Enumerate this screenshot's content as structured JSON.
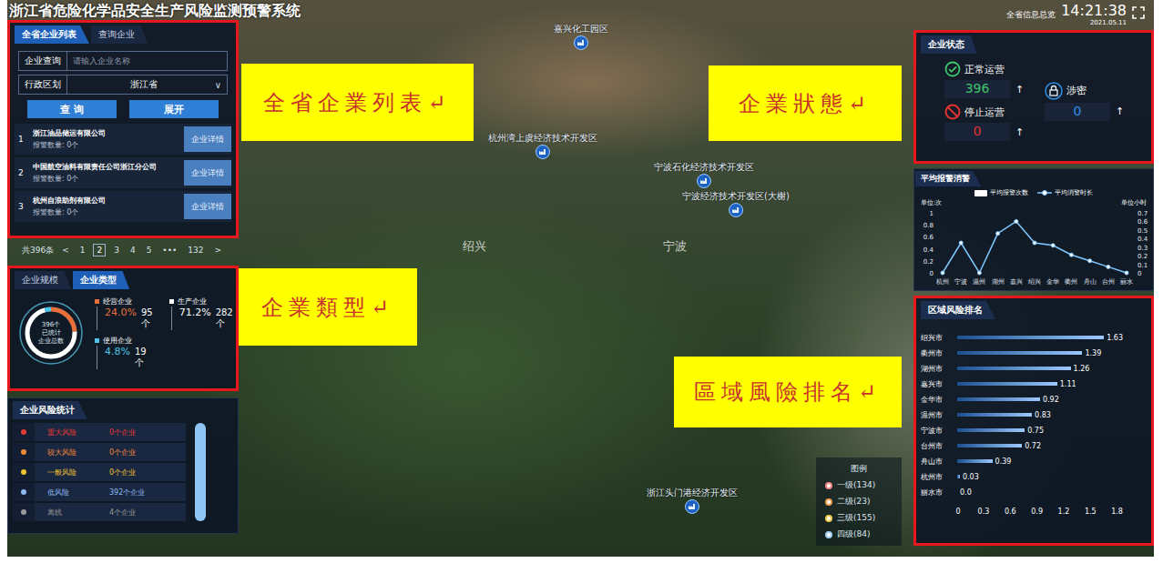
{
  "header": {
    "title": "浙江省危险化学品安全生产风险监测预警系统",
    "overview": "全省信息总览",
    "time": "14:21:38",
    "date": "2021.05.11"
  },
  "enterprise_list": {
    "highlighted": true,
    "tabs": [
      {
        "label": "全省企业列表",
        "selected": true
      },
      {
        "label": "查询企业",
        "selected": false
      }
    ],
    "search": {
      "label": "企业查询",
      "placeholder": "请输入企业名称"
    },
    "region": {
      "label": "行政区划",
      "value": "浙江省",
      "arrow": "∨"
    },
    "buttons": [
      "查 询",
      "展开"
    ],
    "items": [
      {
        "index": "1",
        "name": "浙江油品储运有限公司",
        "alarms": "报警数量: 0个",
        "action": "企业详情"
      },
      {
        "index": "2",
        "name": "中国航空油料有限责任公司浙江分公司",
        "alarms": "报警数量: 0个",
        "action": "企业详情"
      },
      {
        "index": "3",
        "name": "杭州自浪助剂有限公司",
        "alarms": "报警数量: 0个",
        "action": "企业详情"
      }
    ],
    "pagination": {
      "total": "共396条",
      "prev": "<",
      "next": ">",
      "pages": [
        {
          "label": "1",
          "selected": false
        },
        {
          "label": "2",
          "selected": true
        },
        {
          "label": "3",
          "selected": false
        },
        {
          "label": "4",
          "selected": false
        },
        {
          "label": "5",
          "selected": false
        },
        {
          "label": "•••",
          "selected": false
        },
        {
          "label": "132",
          "selected": false
        }
      ]
    }
  },
  "enterprise_type": {
    "highlighted": true,
    "tabs": [
      {
        "label": "企业规模",
        "selected": false
      },
      {
        "label": "企业类型",
        "selected": true
      }
    ],
    "center": [
      "396个",
      "已统计",
      "企业总数"
    ],
    "items": [
      {
        "label": "经营企业",
        "percent": "24.0%",
        "count": "95个",
        "share": 0.24,
        "color": "#e8703a"
      },
      {
        "label": "生产企业",
        "percent": "71.2%",
        "count": "282个",
        "share": 0.712,
        "color": "#ffffff"
      },
      {
        "label": "使用企业",
        "percent": "4.8%",
        "count": "19个",
        "share": 0.048,
        "color": "#4fc3e8"
      }
    ]
  },
  "risk_stats": {
    "title": "企业风险统计",
    "items": [
      {
        "label": "重大风险",
        "count": "0个企业",
        "color": "#e53935"
      },
      {
        "label": "较大风险",
        "count": "0个企业",
        "color": "#f08a3a"
      },
      {
        "label": "一般风险",
        "count": "0个企业",
        "color": "#f2c230"
      },
      {
        "label": "低风险",
        "count": "392个企业",
        "color": "#8fb8f0"
      },
      {
        "label": "离线",
        "count": "4个企业",
        "color": "#9a9a9a"
      }
    ]
  },
  "enterprise_status": {
    "highlighted": true,
    "title": "企业状态",
    "items": [
      {
        "label": "正常运营",
        "value": "396",
        "trend": "↑",
        "kind": "normal",
        "color": "#3ec46d"
      },
      {
        "label": "停止运营",
        "value": "0",
        "trend": "↑",
        "kind": "stopped",
        "color": "#e0332f"
      },
      {
        "label": "涉密",
        "value": "0",
        "trend": "↑",
        "kind": "secret",
        "color": "#2b8fe6"
      }
    ]
  },
  "alarm_chart": {
    "title": "平均报警消警",
    "legend": [
      {
        "label": "平均报警次数",
        "kind": "bar"
      },
      {
        "label": "平均消警时长",
        "kind": "line"
      }
    ],
    "left_unit": "单位:次",
    "right_unit": "单位小时",
    "left_ticks": [
      "1",
      "0.8",
      "0.6",
      "0.4",
      "0.2",
      "0"
    ],
    "right_ticks": [
      "0.7",
      "0.6",
      "0.5",
      "0.4",
      "0.3",
      "0.2",
      "0.1",
      "0"
    ],
    "categories": [
      "杭州",
      "宁波",
      "温州",
      "湖州",
      "嘉兴",
      "绍兴",
      "金华",
      "衢州",
      "舟山",
      "台州",
      "丽水"
    ],
    "alarm_count": [
      0,
      0,
      0,
      0,
      0,
      0,
      0,
      0,
      0,
      0,
      0
    ],
    "clear_hours": [
      0,
      0.35,
      0,
      0.46,
      0.6,
      0.35,
      0.32,
      0.21,
      0.14,
      0.07,
      0
    ]
  },
  "region_risk": {
    "highlighted": true,
    "title": "区域风险排名",
    "items": [
      {
        "name": "绍兴市",
        "value": 1.63,
        "reading": "1.63"
      },
      {
        "name": "衢州市",
        "value": 1.39,
        "reading": "1.39"
      },
      {
        "name": "湖州市",
        "value": 1.26,
        "reading": "1.26"
      },
      {
        "name": "嘉兴市",
        "value": 1.11,
        "reading": "1.11"
      },
      {
        "name": "金华市",
        "value": 0.92,
        "reading": "0.92"
      },
      {
        "name": "温州市",
        "value": 0.83,
        "reading": "0.83"
      },
      {
        "name": "宁波市",
        "value": 0.75,
        "reading": "0.75"
      },
      {
        "name": "台州市",
        "value": 0.72,
        "reading": "0.72"
      },
      {
        "name": "舟山市",
        "value": 0.39,
        "reading": "0.39"
      },
      {
        "name": "杭州市",
        "value": 0.03,
        "reading": "0.03"
      },
      {
        "name": "丽水市",
        "value": 0.0,
        "reading": "0.0"
      }
    ],
    "ticks": [
      "0",
      "0.3",
      "0.6",
      "0.9",
      "1.2",
      "1.5",
      "1.8"
    ]
  },
  "map": {
    "regions": [
      "绍兴",
      "宁波"
    ],
    "pins": [
      "嘉兴化工园区",
      "杭州湾上虞经济技术开发区",
      "宁波石化经济技术开发区",
      "宁波经济技术开发区(大榭)",
      "浙江头门港经济开发区"
    ],
    "legend": {
      "title": "图例",
      "items": [
        {
          "label": "一级(134)",
          "color": "#f08a8a"
        },
        {
          "label": "二级(23)",
          "color": "#f0a050"
        },
        {
          "label": "三级(155)",
          "color": "#f0d050"
        },
        {
          "label": "四级(84)",
          "color": "#9fd0f0"
        }
      ]
    }
  },
  "annotations": [
    "全省企業列表↵",
    "企業狀態↵",
    "企業類型↵",
    "區域風險排名↵"
  ]
}
